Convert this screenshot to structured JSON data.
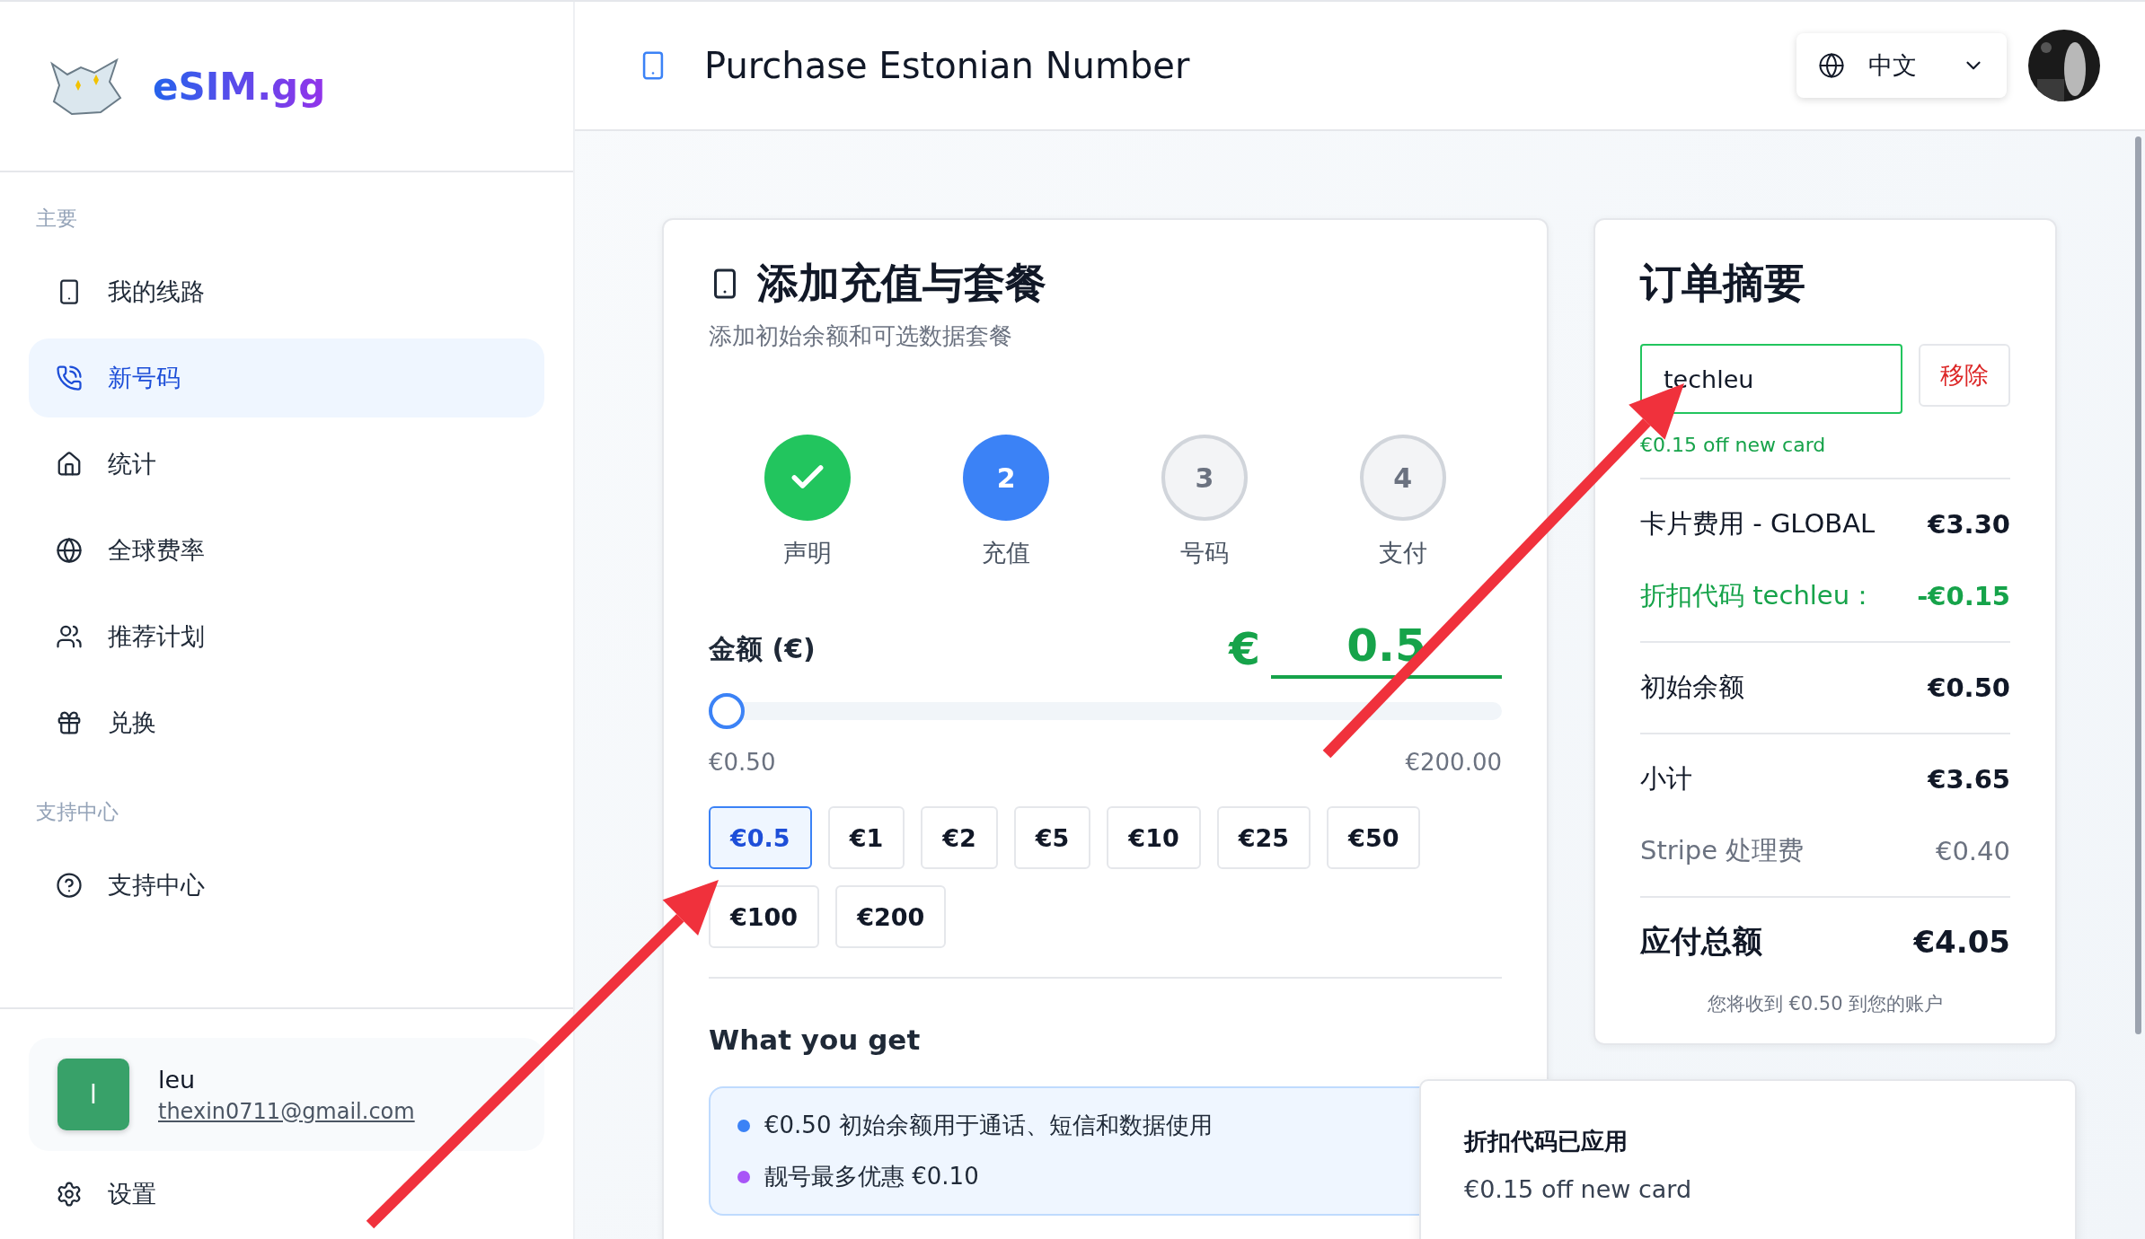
{
  "sidebar": {
    "brand": "eSIM.gg",
    "sections": [
      {
        "title": "主要",
        "items": [
          {
            "label": "我的线路",
            "selected": false
          },
          {
            "label": "新号码",
            "selected": true
          },
          {
            "label": "统计",
            "selected": false
          },
          {
            "label": "全球费率",
            "selected": false
          },
          {
            "label": "推荐计划",
            "selected": false
          },
          {
            "label": "兑换",
            "selected": false
          }
        ]
      },
      {
        "title": "支持中心",
        "items": [
          {
            "label": "支持中心",
            "selected": false
          }
        ]
      }
    ],
    "user": {
      "initial": "l",
      "name": "leu",
      "email": "thexin0711@gmail.com"
    },
    "settings": "设置"
  },
  "header": {
    "title": "Purchase Estonian Number",
    "language": "中文"
  },
  "topup_card": {
    "title": "添加充值与套餐",
    "subtitle": "添加初始余额和可选数据套餐",
    "steps": [
      {
        "label": "声明",
        "completed": true,
        "selected": false
      },
      {
        "number": "2",
        "label": "充值",
        "completed": false,
        "selected": true
      },
      {
        "number": "3",
        "label": "号码",
        "completed": false,
        "selected": false
      },
      {
        "number": "4",
        "label": "支付",
        "completed": false,
        "selected": false
      }
    ],
    "amount": {
      "label": "金额 (€)",
      "currency": "€",
      "value": "0.5",
      "level": 0,
      "min": "€0.50",
      "max": "€200.00"
    },
    "presets": [
      {
        "label": "€0.5",
        "selected": true
      },
      {
        "label": "€1",
        "selected": false
      },
      {
        "label": "€2",
        "selected": false
      },
      {
        "label": "€5",
        "selected": false
      },
      {
        "label": "€10",
        "selected": false
      },
      {
        "label": "€25",
        "selected": false
      },
      {
        "label": "€50",
        "selected": false
      },
      {
        "label": "€100",
        "selected": false
      },
      {
        "label": "€200",
        "selected": false
      }
    ],
    "what_you_get": {
      "title": "What you get",
      "items": [
        {
          "text": "€0.50 初始余额用于通话、短信和数据使用",
          "color": "#3b82f6"
        },
        {
          "text": "靓号最多优惠 €0.10",
          "color": "#a855f7"
        }
      ]
    }
  },
  "order_summary": {
    "title": "订单摘要",
    "coupon": {
      "value": "techleu",
      "remove": "移除",
      "note": "€0.15 off new card"
    },
    "groups": [
      [
        {
          "label": "卡片费用 - GLOBAL",
          "amount": "€3.30",
          "kind": "normal"
        },
        {
          "label": "折扣代码 techleu：",
          "amount": "-€0.15",
          "kind": "discount"
        }
      ],
      [
        {
          "label": "初始余额",
          "amount": "€0.50",
          "kind": "normal"
        }
      ],
      [
        {
          "label": "小计",
          "amount": "€3.65",
          "kind": "normal"
        },
        {
          "label": "Stripe 处理费",
          "amount": "€0.40",
          "kind": "muted"
        }
      ]
    ],
    "total": {
      "label": "应付总额",
      "amount": "€4.05"
    },
    "footnote": "您将收到 €0.50 到您的账户"
  },
  "toast": {
    "title": "折扣代码已应用",
    "message": "€0.15 off new card"
  },
  "annotations": [
    {
      "kind": "arrow"
    },
    {
      "kind": "arrow"
    }
  ]
}
